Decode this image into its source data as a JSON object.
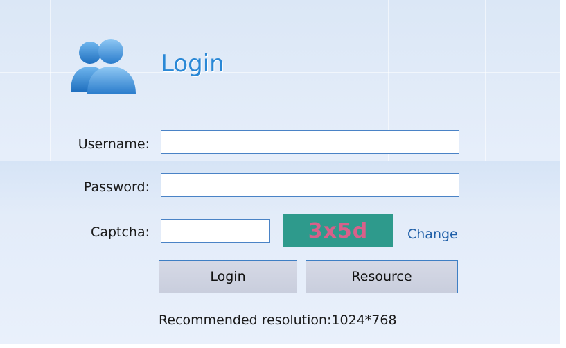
{
  "header": {
    "title": "Login",
    "icon": "users-icon"
  },
  "form": {
    "username_label": "Username:",
    "username_value": "",
    "password_label": "Password:",
    "password_value": "",
    "captcha_label": "Captcha:",
    "captcha_value": "",
    "captcha_image_text": "3x5d",
    "change_link": "Change"
  },
  "buttons": {
    "login_label": "Login",
    "resource_label": "Resource"
  },
  "footer": {
    "hint": "Recommended resolution:1024*768"
  },
  "colors": {
    "accent": "#2a88d6",
    "field_border": "#4a83c6",
    "captcha_bg": "#2e9a8c",
    "captcha_text": "#d8608a",
    "link": "#1f5fa8"
  }
}
